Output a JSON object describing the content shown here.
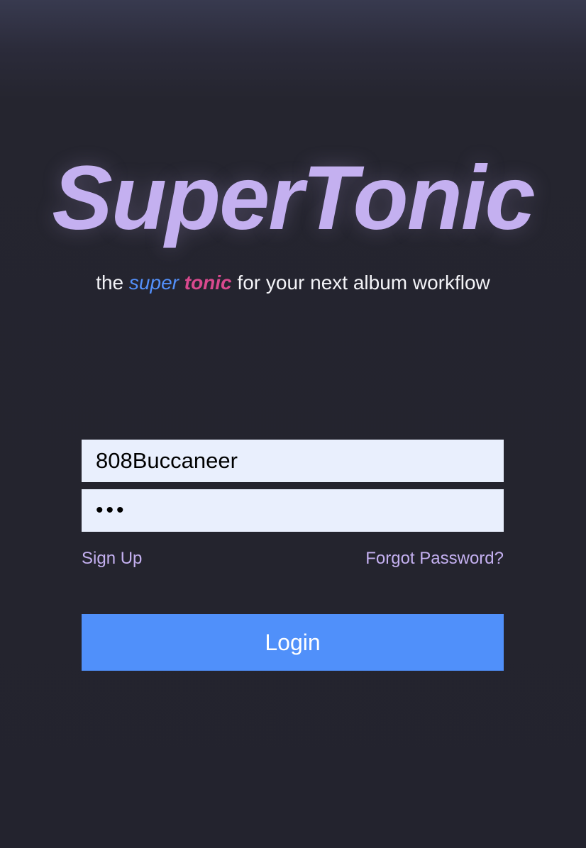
{
  "app": {
    "brand": "SuperTonic"
  },
  "tagline": {
    "prefix": "the",
    "super": "super",
    "tonic": "tonic",
    "suffix": "for your next album workflow"
  },
  "form": {
    "username_value": "808Buccaneer",
    "password_mask": "•••"
  },
  "links": {
    "sign_up": "Sign Up",
    "forgot_password": "Forgot Password?"
  },
  "actions": {
    "login_label": "Login"
  },
  "colors": {
    "background": "#23232e",
    "brand": "#c4b0f0",
    "super_accent": "#5390fb",
    "tonic_accent": "#d9498e",
    "button": "#5090fa",
    "input_bg": "#e9effd"
  }
}
